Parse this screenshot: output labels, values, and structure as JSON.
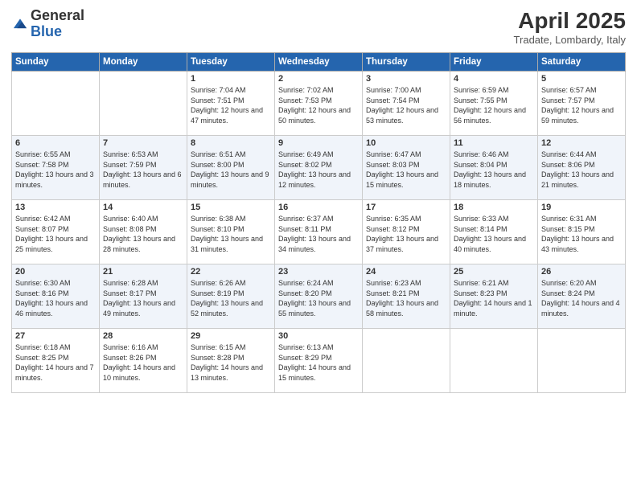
{
  "logo": {
    "general": "General",
    "blue": "Blue"
  },
  "title": "April 2025",
  "subtitle": "Tradate, Lombardy, Italy",
  "headers": [
    "Sunday",
    "Monday",
    "Tuesday",
    "Wednesday",
    "Thursday",
    "Friday",
    "Saturday"
  ],
  "weeks": [
    [
      {
        "day": "",
        "info": ""
      },
      {
        "day": "",
        "info": ""
      },
      {
        "day": "1",
        "info": "Sunrise: 7:04 AM\nSunset: 7:51 PM\nDaylight: 12 hours and 47 minutes."
      },
      {
        "day": "2",
        "info": "Sunrise: 7:02 AM\nSunset: 7:53 PM\nDaylight: 12 hours and 50 minutes."
      },
      {
        "day": "3",
        "info": "Sunrise: 7:00 AM\nSunset: 7:54 PM\nDaylight: 12 hours and 53 minutes."
      },
      {
        "day": "4",
        "info": "Sunrise: 6:59 AM\nSunset: 7:55 PM\nDaylight: 12 hours and 56 minutes."
      },
      {
        "day": "5",
        "info": "Sunrise: 6:57 AM\nSunset: 7:57 PM\nDaylight: 12 hours and 59 minutes."
      }
    ],
    [
      {
        "day": "6",
        "info": "Sunrise: 6:55 AM\nSunset: 7:58 PM\nDaylight: 13 hours and 3 minutes."
      },
      {
        "day": "7",
        "info": "Sunrise: 6:53 AM\nSunset: 7:59 PM\nDaylight: 13 hours and 6 minutes."
      },
      {
        "day": "8",
        "info": "Sunrise: 6:51 AM\nSunset: 8:00 PM\nDaylight: 13 hours and 9 minutes."
      },
      {
        "day": "9",
        "info": "Sunrise: 6:49 AM\nSunset: 8:02 PM\nDaylight: 13 hours and 12 minutes."
      },
      {
        "day": "10",
        "info": "Sunrise: 6:47 AM\nSunset: 8:03 PM\nDaylight: 13 hours and 15 minutes."
      },
      {
        "day": "11",
        "info": "Sunrise: 6:46 AM\nSunset: 8:04 PM\nDaylight: 13 hours and 18 minutes."
      },
      {
        "day": "12",
        "info": "Sunrise: 6:44 AM\nSunset: 8:06 PM\nDaylight: 13 hours and 21 minutes."
      }
    ],
    [
      {
        "day": "13",
        "info": "Sunrise: 6:42 AM\nSunset: 8:07 PM\nDaylight: 13 hours and 25 minutes."
      },
      {
        "day": "14",
        "info": "Sunrise: 6:40 AM\nSunset: 8:08 PM\nDaylight: 13 hours and 28 minutes."
      },
      {
        "day": "15",
        "info": "Sunrise: 6:38 AM\nSunset: 8:10 PM\nDaylight: 13 hours and 31 minutes."
      },
      {
        "day": "16",
        "info": "Sunrise: 6:37 AM\nSunset: 8:11 PM\nDaylight: 13 hours and 34 minutes."
      },
      {
        "day": "17",
        "info": "Sunrise: 6:35 AM\nSunset: 8:12 PM\nDaylight: 13 hours and 37 minutes."
      },
      {
        "day": "18",
        "info": "Sunrise: 6:33 AM\nSunset: 8:14 PM\nDaylight: 13 hours and 40 minutes."
      },
      {
        "day": "19",
        "info": "Sunrise: 6:31 AM\nSunset: 8:15 PM\nDaylight: 13 hours and 43 minutes."
      }
    ],
    [
      {
        "day": "20",
        "info": "Sunrise: 6:30 AM\nSunset: 8:16 PM\nDaylight: 13 hours and 46 minutes."
      },
      {
        "day": "21",
        "info": "Sunrise: 6:28 AM\nSunset: 8:17 PM\nDaylight: 13 hours and 49 minutes."
      },
      {
        "day": "22",
        "info": "Sunrise: 6:26 AM\nSunset: 8:19 PM\nDaylight: 13 hours and 52 minutes."
      },
      {
        "day": "23",
        "info": "Sunrise: 6:24 AM\nSunset: 8:20 PM\nDaylight: 13 hours and 55 minutes."
      },
      {
        "day": "24",
        "info": "Sunrise: 6:23 AM\nSunset: 8:21 PM\nDaylight: 13 hours and 58 minutes."
      },
      {
        "day": "25",
        "info": "Sunrise: 6:21 AM\nSunset: 8:23 PM\nDaylight: 14 hours and 1 minute."
      },
      {
        "day": "26",
        "info": "Sunrise: 6:20 AM\nSunset: 8:24 PM\nDaylight: 14 hours and 4 minutes."
      }
    ],
    [
      {
        "day": "27",
        "info": "Sunrise: 6:18 AM\nSunset: 8:25 PM\nDaylight: 14 hours and 7 minutes."
      },
      {
        "day": "28",
        "info": "Sunrise: 6:16 AM\nSunset: 8:26 PM\nDaylight: 14 hours and 10 minutes."
      },
      {
        "day": "29",
        "info": "Sunrise: 6:15 AM\nSunset: 8:28 PM\nDaylight: 14 hours and 13 minutes."
      },
      {
        "day": "30",
        "info": "Sunrise: 6:13 AM\nSunset: 8:29 PM\nDaylight: 14 hours and 15 minutes."
      },
      {
        "day": "",
        "info": ""
      },
      {
        "day": "",
        "info": ""
      },
      {
        "day": "",
        "info": ""
      }
    ]
  ]
}
